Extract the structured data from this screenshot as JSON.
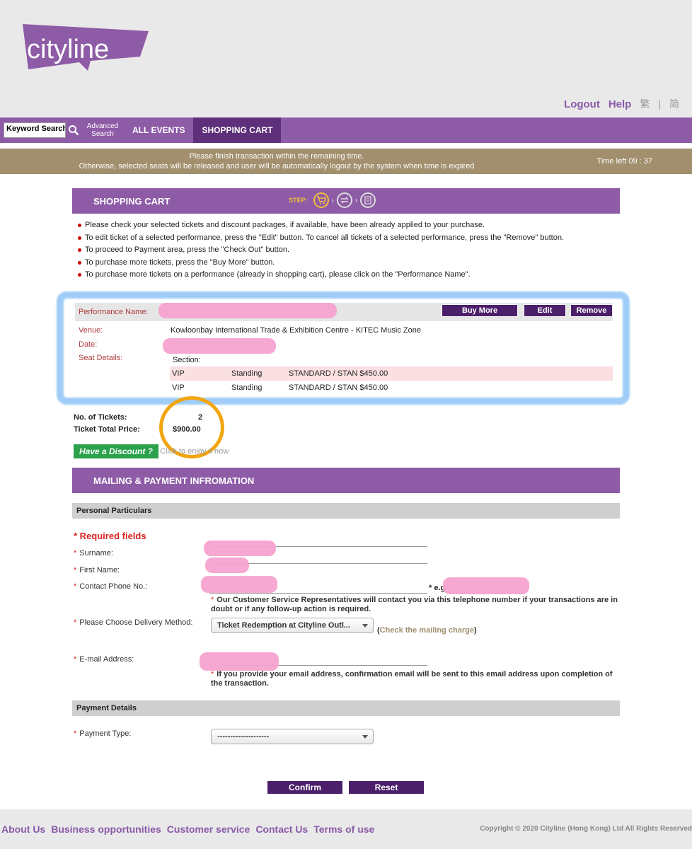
{
  "header": {
    "logo_text": "cityline",
    "links": {
      "logout": "Logout",
      "help": "Help",
      "lang_trad": "繁",
      "lang_sep": "|",
      "lang_simp": "简"
    }
  },
  "nav": {
    "keyword_search": "Keyword Search",
    "advanced_search": "Advanced Search",
    "tabs": [
      "ALL EVENTS",
      "SHOPPING CART"
    ]
  },
  "timebar": {
    "line1": "Please finish transaction within the remaining time.",
    "line2": "Otherwise, selected seats will be released and user will be automatically logout by the system when time is expired",
    "time_left": "Time left 09 : 37"
  },
  "cart": {
    "title": "SHOPPING CART",
    "step_label": "STEP:",
    "instructions": [
      "Please check your selected tickets and discount packages, if available, have been already applied to your purchase.",
      "To edit ticket of a selected performance, press the \"Edit\" button. To cancel all tickets of a selected performance, press the \"Remove\" button.",
      "To proceed to Payment area, press the \"Check Out\" button.",
      "To purchase more tickets, press the \"Buy More\" button.",
      "To purchase more tickets on a performance (already in shopping cart), please click on the \"Performance Name\"."
    ],
    "performance": {
      "name_label": "Performance Name:",
      "buttons": {
        "buy_more": "Buy More",
        "edit": "Edit",
        "remove": "Remove"
      },
      "venue_label": "Venue:",
      "venue": "Kowloonbay International Trade & Exhibition Centre - KITEC Music Zone",
      "date_label": "Date:",
      "seat_label": "Seat Details:",
      "section_label": "Section:",
      "seats": [
        {
          "zone": "VIP",
          "type": "Standing",
          "price": "STANDARD / STAN $450.00"
        },
        {
          "zone": "VIP",
          "type": "Standing",
          "price": "STANDARD / STAN $450.00"
        }
      ]
    },
    "totals": {
      "tickets_label": "No. of Tickets:",
      "tickets": "2",
      "price_label": "Ticket Total Price:",
      "price": "$900.00"
    },
    "discount": {
      "button": "Have a Discount ?",
      "note": "Click to enjoy it now"
    }
  },
  "mailing": {
    "title": "MAILING & PAYMENT INFROMATION",
    "personal_title": "Personal Particulars",
    "required": "* Required fields",
    "asterisk": "*",
    "surname": "Surname:",
    "first_name": "First Name:",
    "phone": "Contact Phone No.:",
    "phone_eg": "* e.g",
    "phone_note": "Our Customer Service Representatives will contact you via this telephone number if your transactions are in doubt or if any follow-up action is required.",
    "delivery_label": "Please Choose Delivery Method:",
    "delivery_value": "Ticket Redemption at Cityline Outl...",
    "mailing_charge_open": "(",
    "mailing_charge": "Check the mailing charge",
    "mailing_charge_close": ")",
    "email_label": "E-mail Address:",
    "email_note": "If you provide your email address, confirmation email will be sent to this email address upon completion of the transaction.",
    "payment_title": "Payment Details",
    "payment_label": "Payment Type:",
    "payment_value": "--------------------",
    "confirm": "Confirm",
    "reset": "Reset"
  },
  "footer": {
    "links": [
      "About Us",
      "Business opportunities",
      "Customer service",
      "Contact Us",
      "Terms of use"
    ],
    "copyright": "Copyright © 2020 Cityline (Hong Kong) Ltd All Rights Reserved"
  },
  "colors": {
    "brand_purple": "#8e5ba6",
    "dark_purple": "#4b1f6a",
    "time_bar": "#a18f6d",
    "discount_green": "#2aa14a",
    "required_red": "#d22222"
  }
}
